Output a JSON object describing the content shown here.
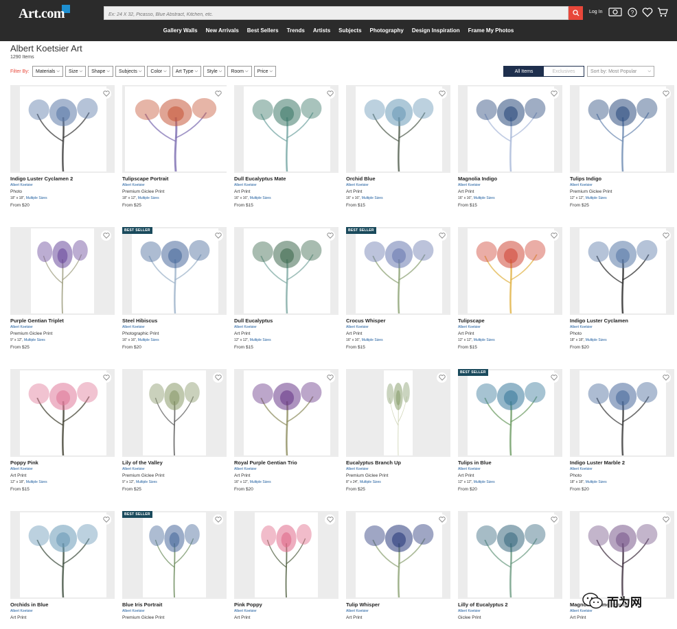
{
  "header": {
    "logo": "Art.com",
    "search_placeholder": "Ex: 24 X 32, Picasso, Blue Abstract, Kitchen, etc.",
    "login": "Log In",
    "nav": [
      "Gallery Walls",
      "New Arrivals",
      "Best Sellers",
      "Trends",
      "Artists",
      "Subjects",
      "Photography",
      "Design Inspiration",
      "Frame My Photos"
    ]
  },
  "page": {
    "title": "Albert Koetsier Art",
    "count": "1290 Items"
  },
  "filters": {
    "label": "Filter By:",
    "items": [
      "Materials",
      "Size",
      "Shape",
      "Subjects",
      "Color",
      "Art Type",
      "Style",
      "Room",
      "Price"
    ],
    "toggle_on": "All Items",
    "toggle_off": "Exclusives",
    "sort": "Sort by: Most Popular"
  },
  "products": [
    {
      "title": "Indigo Luster Cyclamen 2",
      "artist": "Albert Koetsier",
      "type": "Photo",
      "size": "18\" x 18\",",
      "multi": "Multiple Sizes",
      "price": "From $20",
      "badge": "",
      "colors": [
        "#5c7aa8",
        "#333"
      ]
    },
    {
      "title": "Tulipscape Portrait",
      "artist": "Albert Koetsier",
      "type": "Premium Giclee Print",
      "size": "18\" x 12\",",
      "multi": "Multiple Sizes",
      "price": "From $25",
      "badge": "",
      "colors": [
        "#c75a3c",
        "#7b6bb0"
      ]
    },
    {
      "title": "Dull Eucalyptus Mate",
      "artist": "Albert Koetsier",
      "type": "Art Print",
      "size": "16\" x 16\",",
      "multi": "Multiple Sizes",
      "price": "From $15",
      "badge": "",
      "colors": [
        "#3f7a6a",
        "#6fa3a0"
      ]
    },
    {
      "title": "Orchid Blue",
      "artist": "Albert Koetsier",
      "type": "Art Print",
      "size": "16\" x 16\",",
      "multi": "Multiple Sizes",
      "price": "From $15",
      "badge": "",
      "colors": [
        "#6a9ab8",
        "#4d5a4a"
      ]
    },
    {
      "title": "Magnolia Indigo",
      "artist": "Albert Koetsier",
      "type": "Art Print",
      "size": "16\" x 16\",",
      "multi": "Multiple Sizes",
      "price": "From $15",
      "badge": "",
      "colors": [
        "#2a4a7c",
        "#a8b8d8"
      ]
    },
    {
      "title": "Tulips Indigo",
      "artist": "Albert Koetsier",
      "type": "Premium Giclee Print",
      "size": "12\" x 12\",",
      "multi": "Multiple Sizes",
      "price": "From $25",
      "badge": "",
      "colors": [
        "#2f4f80",
        "#6a88b0"
      ]
    },
    {
      "title": "Purple Gentian Triplet",
      "artist": "Albert Koetsier",
      "type": "Premium Giclee Print",
      "size": "9\" x 12\",",
      "multi": "Multiple Sizes",
      "price": "From $25",
      "badge": "",
      "colors": [
        "#6a4a9c",
        "#9a9a7a"
      ]
    },
    {
      "title": "Steel Hibiscus",
      "artist": "Albert Koetsier",
      "type": "Photographic Print",
      "size": "16\" x 16\",",
      "multi": "Multiple Sizes",
      "price": "From $20",
      "badge": "BEST SELLER",
      "colors": [
        "#4a6a9c",
        "#9ab0c8"
      ]
    },
    {
      "title": "Dull Eucalyptus",
      "artist": "Albert Koetsier",
      "type": "Art Print",
      "size": "12\" x 12\",",
      "multi": "Multiple Sizes",
      "price": "From $15",
      "badge": "",
      "colors": [
        "#3f6a50",
        "#7aa6a0"
      ]
    },
    {
      "title": "Crocus Whisper",
      "artist": "Albert Koetsier",
      "type": "Art Print",
      "size": "16\" x 16\",",
      "multi": "Multiple Sizes",
      "price": "From $15",
      "badge": "BEST SELLER",
      "colors": [
        "#6a7ab0",
        "#8aa070"
      ]
    },
    {
      "title": "Tulipscape",
      "artist": "Albert Koetsier",
      "type": "Art Print",
      "size": "12\" x 12\",",
      "multi": "Multiple Sizes",
      "price": "From $15",
      "badge": "",
      "colors": [
        "#d04a3a",
        "#e0b040"
      ]
    },
    {
      "title": "Indigo Luster Cyclamen",
      "artist": "Albert Koetsier",
      "type": "Photo",
      "size": "18\" x 18\",",
      "multi": "Multiple Sizes",
      "price": "From $20",
      "badge": "",
      "colors": [
        "#5a7aa8",
        "#222"
      ]
    },
    {
      "title": "Poppy Pink",
      "artist": "Albert Koetsier",
      "type": "Art Print",
      "size": "12\" x 18\",",
      "multi": "Multiple Sizes",
      "price": "From $15",
      "badge": "",
      "colors": [
        "#e07a9a",
        "#3a3a2a"
      ]
    },
    {
      "title": "Lily of the Valley",
      "artist": "Albert Koetsier",
      "type": "Premium Giclee Print",
      "size": "9\" x 12\",",
      "multi": "Multiple Sizes",
      "price": "From $25",
      "badge": "",
      "colors": [
        "#8a9a6a",
        "#555"
      ]
    },
    {
      "title": "Royal Purple Gentian Trio",
      "artist": "Albert Koetsier",
      "type": "Art Print",
      "size": "16\" x 12\",",
      "multi": "Multiple Sizes",
      "price": "From $20",
      "badge": "",
      "colors": [
        "#6a3a8a",
        "#8a8a5a"
      ]
    },
    {
      "title": "Eucalyptus Branch Up",
      "artist": "Albert Koetsier",
      "type": "Premium Giclee Print",
      "size": "8\" x 24\",",
      "multi": "Multiple Sizes",
      "price": "From $25",
      "badge": "",
      "colors": [
        "#8aa070",
        "#c0c8a0"
      ]
    },
    {
      "title": "Tulips in Blue",
      "artist": "Albert Koetsier",
      "type": "Art Print",
      "size": "12\" x 12\",",
      "multi": "Multiple Sizes",
      "price": "From $20",
      "badge": "BEST SELLER",
      "colors": [
        "#3a7a9c",
        "#6a9a60"
      ]
    },
    {
      "title": "Indigo Luster Marble 2",
      "artist": "Albert Koetsier",
      "type": "Photo",
      "size": "18\" x 18\",",
      "multi": "Multiple Sizes",
      "price": "From $20",
      "badge": "",
      "colors": [
        "#4a6a9c",
        "#333"
      ]
    },
    {
      "title": "Orchids in Blue",
      "artist": "Albert Koetsier",
      "type": "Art Print",
      "size": "",
      "multi": "",
      "price": "",
      "badge": "",
      "colors": [
        "#6a9ab8",
        "#3a4a3a"
      ]
    },
    {
      "title": "Blue Iris Portrait",
      "artist": "Albert Koetsier",
      "type": "Premium Giclee Print",
      "size": "",
      "multi": "",
      "price": "",
      "badge": "BEST SELLER",
      "colors": [
        "#4a6a9c",
        "#6a8a5a"
      ]
    },
    {
      "title": "Pink Poppy",
      "artist": "Albert Koetsier",
      "type": "Art Print",
      "size": "",
      "multi": "",
      "price": "",
      "badge": "",
      "colors": [
        "#e06a8a",
        "#4a5a3a"
      ]
    },
    {
      "title": "Tulip Whisper",
      "artist": "Albert Koetsier",
      "type": "Art Print",
      "size": "",
      "multi": "",
      "price": "",
      "badge": "",
      "colors": [
        "#2a3a7c",
        "#8aa070"
      ]
    },
    {
      "title": "Lilly of Eucalyptus 2",
      "artist": "Albert Koetsier",
      "type": "Giclee Print",
      "size": "",
      "multi": "",
      "price": "",
      "badge": "",
      "colors": [
        "#3a6a80",
        "#6a9a80"
      ]
    },
    {
      "title": "Magnolia Plume Beauty",
      "artist": "Albert Koetsier",
      "type": "Art Print",
      "size": "",
      "multi": "",
      "price": "",
      "badge": "",
      "colors": [
        "#7a5a8c",
        "#3a2a3a"
      ]
    }
  ],
  "watermark": "而为网"
}
